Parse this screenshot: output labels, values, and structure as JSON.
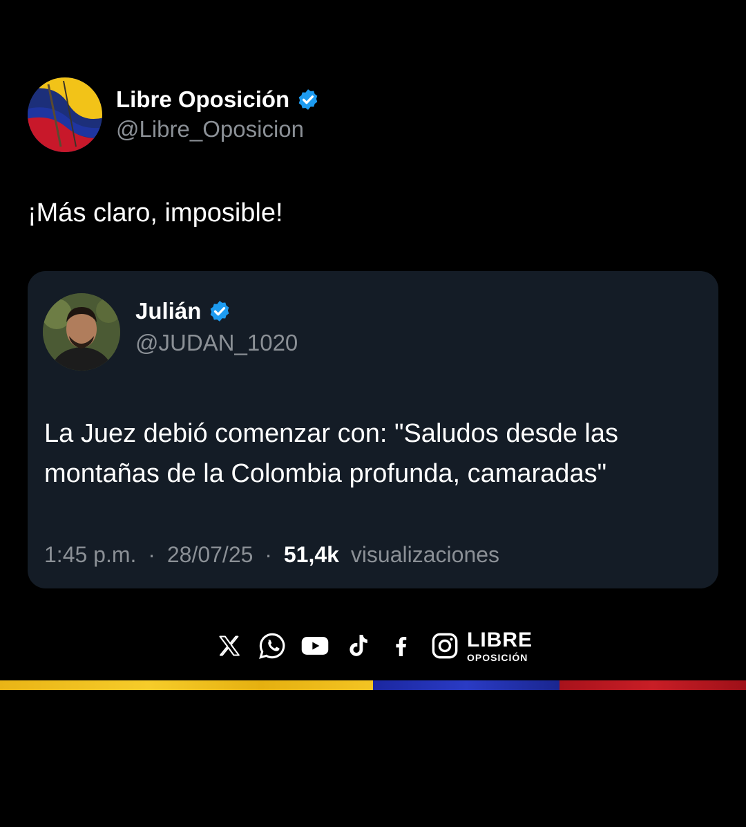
{
  "post": {
    "author_name": "Libre Oposición",
    "author_handle": "@Libre_Oposicion",
    "text": "¡Más claro, imposible!"
  },
  "quote": {
    "author_name": "Julián",
    "author_handle": "@JUDAN_1020",
    "text": "La Juez debió comenzar con: \"Saludos desde las montañas de la Colombia profunda, camaradas\"",
    "time": "1:45 p.m.",
    "separator": "·",
    "date": "28/07/25",
    "views_count": "51,4k",
    "views_label": "visualizaciones"
  },
  "footer": {
    "social_icons": [
      "x-icon",
      "whatsapp-icon",
      "youtube-icon",
      "tiktok-icon",
      "facebook-icon",
      "instagram-icon"
    ],
    "brand_line1": "LIBRE",
    "brand_line2": "OPOSICIÓN",
    "flag_colors": [
      "#f4c21a",
      "#1f2fa8",
      "#b3141c"
    ]
  },
  "colors": {
    "background": "#000000",
    "card": "#141c26",
    "secondary_text": "#8b9096",
    "verified": "#1d9bf0"
  }
}
